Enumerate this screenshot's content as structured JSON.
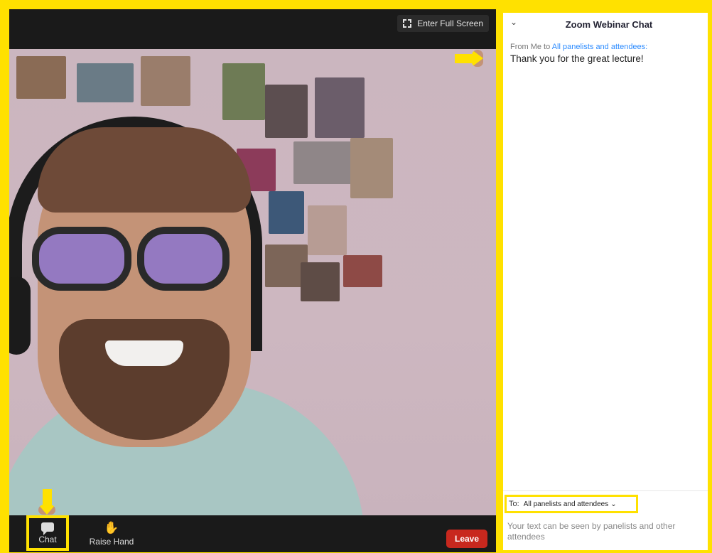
{
  "video": {
    "fullscreen_label": "Enter Full Screen"
  },
  "toolbar": {
    "chat_label": "Chat",
    "raise_hand_label": "Raise Hand",
    "leave_label": "Leave"
  },
  "chat": {
    "title": "Zoom Webinar Chat",
    "message": {
      "from": "From Me to",
      "to": "All panelists and attendees:",
      "text": "Thank you for the great lecture!"
    },
    "compose": {
      "to_label": "To:",
      "recipient": "All panelists and attendees",
      "hint": "Your text can be seen by panelists and other attendees"
    }
  },
  "colors": {
    "highlight": "#ffe100",
    "leave": "#c8281e",
    "link": "#2d8cff",
    "toolbar_bg": "#1a1a1a"
  },
  "icons": {
    "chat": "chat-bubble-icon",
    "raise_hand": "hand-icon",
    "fullscreen": "fullscreen-icon",
    "collapse": "chevron-down-icon",
    "select": "chevron-down-icon"
  }
}
